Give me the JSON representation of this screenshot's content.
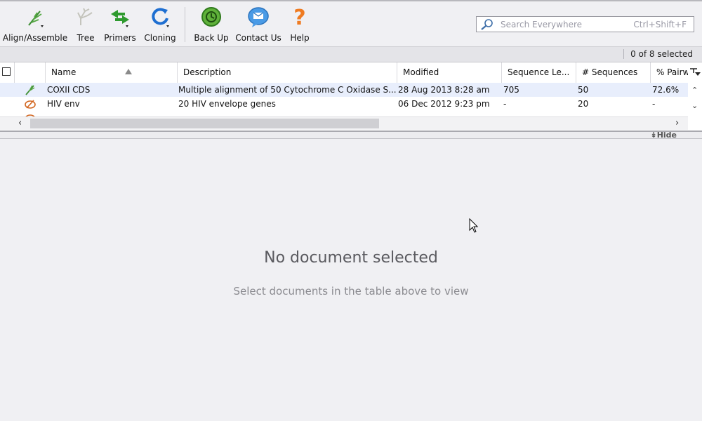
{
  "toolbar": {
    "buttons": [
      {
        "label": "Align/Assemble",
        "icon": "align-assemble-icon"
      },
      {
        "label": "Tree",
        "icon": "tree-icon"
      },
      {
        "label": "Primers",
        "icon": "primers-icon"
      },
      {
        "label": "Cloning",
        "icon": "cloning-icon"
      },
      {
        "label": "Back Up",
        "icon": "backup-icon"
      },
      {
        "label": "Contact Us",
        "icon": "contact-icon"
      },
      {
        "label": "Help",
        "icon": "help-icon"
      }
    ]
  },
  "search": {
    "placeholder": "Search Everywhere",
    "shortcut": "Ctrl+Shift+F"
  },
  "status": {
    "selection": "0 of 8 selected"
  },
  "table": {
    "columns": [
      "Name",
      "Description",
      "Modified",
      "Sequence Le...",
      "# Sequences",
      "% Pairw"
    ],
    "rows": [
      {
        "icon": "alignment-doc-icon",
        "name": "COXII CDS",
        "description": "Multiple alignment of 50 Cytochrome C Oxidase S...",
        "modified": "28 Aug 2013 8:28 am",
        "seq_length": "705",
        "num_sequences": "50",
        "pairwise": "72.6%"
      },
      {
        "icon": "sequence-list-icon",
        "name": "HIV env",
        "description": "20 HIV envelope genes",
        "modified": "06 Dec 2012 9:23 pm",
        "seq_length": "-",
        "num_sequences": "20",
        "pairwise": "-"
      }
    ]
  },
  "pane": {
    "hide_label": "Hide"
  },
  "viewer": {
    "title": "No document selected",
    "subtitle": "Select documents in the table above to view"
  },
  "colors": {
    "selected_row": "#e8eefc",
    "toolbar_bg": "#f0f0f3"
  }
}
